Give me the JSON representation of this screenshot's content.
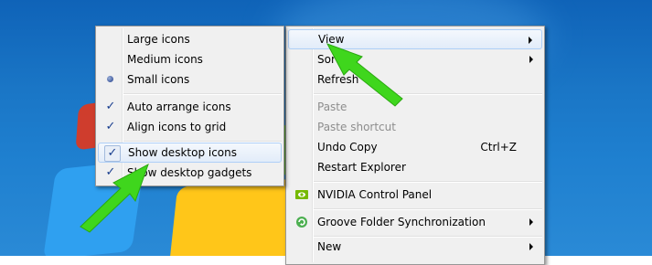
{
  "submenu": {
    "items": [
      {
        "label": "Large icons",
        "type": "plain"
      },
      {
        "label": "Medium icons",
        "type": "plain"
      },
      {
        "label": "Small icons",
        "type": "radio"
      },
      {
        "label": "Auto arrange icons",
        "type": "check"
      },
      {
        "label": "Align icons to grid",
        "type": "check"
      },
      {
        "label": "Show desktop icons",
        "type": "check"
      },
      {
        "label": "Show desktop gadgets",
        "type": "check"
      }
    ]
  },
  "context_menu": {
    "items": [
      {
        "label": "View",
        "submenu": true
      },
      {
        "label": "Sort by",
        "submenu": true
      },
      {
        "label": "Refresh"
      },
      {
        "label": "Paste",
        "disabled": true
      },
      {
        "label": "Paste shortcut",
        "disabled": true
      },
      {
        "label": "Undo Copy",
        "shortcut": "Ctrl+Z"
      },
      {
        "label": "Restart Explorer"
      },
      {
        "label": "NVIDIA Control Panel",
        "icon": "nvidia-icon"
      },
      {
        "label": "Groove Folder Synchronization",
        "icon": "groove-icon",
        "submenu": true
      },
      {
        "label": "New",
        "submenu": true
      }
    ]
  },
  "icons": {
    "check": "✓",
    "nvidia_color": "#76b900",
    "groove_color": "#4caf50"
  },
  "annotation_color": "#3fd61d"
}
